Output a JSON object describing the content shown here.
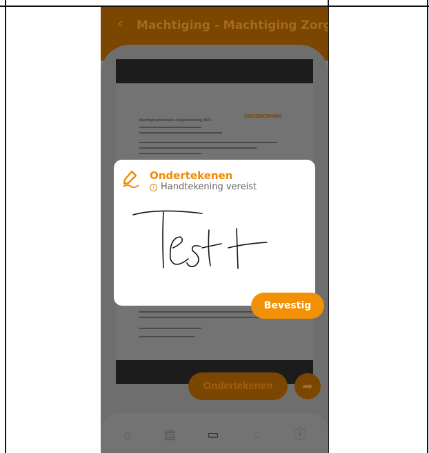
{
  "header": {
    "title": "Machtiging - Machtiging Zorgv...",
    "back_icon": "chevron-left-icon"
  },
  "document": {
    "logo_text": "GOODMORNING",
    "heading": "Machtigingsformulier Zorgverzekering 2023"
  },
  "sign_dialog": {
    "title": "Ondertekenen",
    "subtitle": "Handtekening vereist",
    "info_icon": "info-icon",
    "signature_text": "Test",
    "confirm_label": "Bevestig"
  },
  "actions": {
    "sign_label": "Ondertekenen",
    "share_icon": "share-icon"
  },
  "bottom_nav": {
    "items": [
      "home-icon",
      "document-icon",
      "folder-icon",
      "chat-icon",
      "info-icon"
    ]
  },
  "colors": {
    "accent": "#f39106",
    "overlay": "#7c7c7c"
  }
}
